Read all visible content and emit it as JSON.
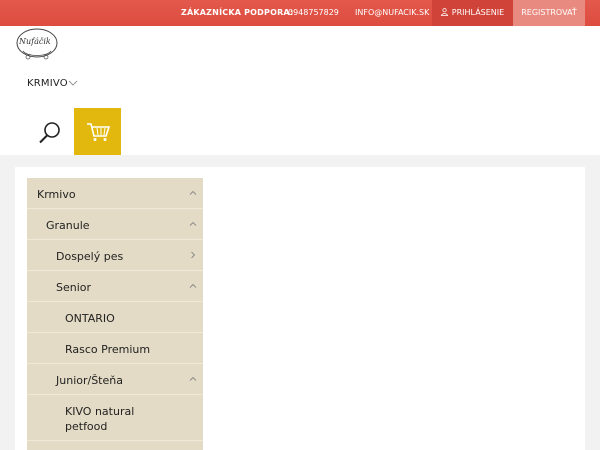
{
  "topbar": {
    "support_label": "ZÁKAZNÍCKA PODPORA:",
    "phone": "0948757829",
    "email": "INFO@NUFACIK.SK",
    "login_label": "PRIHLÁSENIE",
    "register_label": "REGISTROVAŤ",
    "bg_color": "#dd4c3f"
  },
  "header": {
    "logo_text": "Nufáčik",
    "nav_label": "KRMIVO",
    "cart_color": "#e3b80e"
  },
  "sidebar": {
    "bg_color": "#e3dbc5",
    "items": [
      {
        "label": "Krmivo",
        "chevron": "up"
      },
      {
        "label": "Granule",
        "chevron": "up"
      },
      {
        "label": "Dospelý pes",
        "chevron": "right"
      },
      {
        "label": "Senior",
        "chevron": "up"
      },
      {
        "label": "ONTARIO",
        "chevron": ""
      },
      {
        "label": "Rasco Premium",
        "chevron": ""
      },
      {
        "label": "Junior/Šteňa",
        "chevron": "up"
      },
      {
        "label": "KIVO natural petfood",
        "chevron": ""
      }
    ]
  }
}
